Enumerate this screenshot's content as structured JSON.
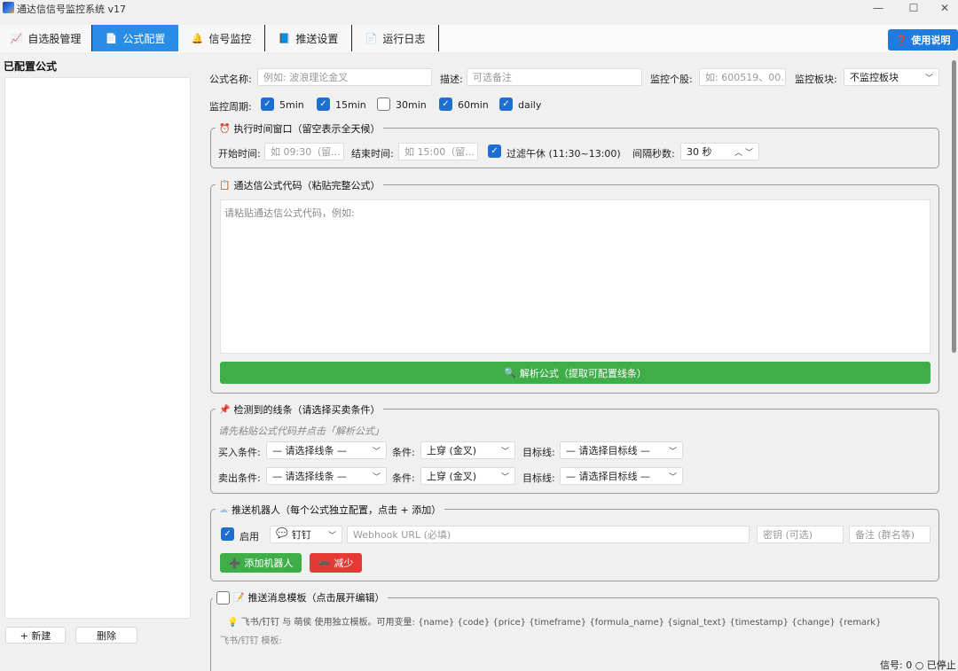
{
  "window": {
    "title": "通达信信号监控系统 v17"
  },
  "tabs": [
    {
      "icon": "📈",
      "label": "自选股管理"
    },
    {
      "icon": "📄",
      "label": "公式配置"
    },
    {
      "icon": "🔔",
      "label": "信号监控"
    },
    {
      "icon": "📘",
      "label": "推送设置"
    },
    {
      "icon": "📄",
      "label": "运行日志"
    }
  ],
  "help_button": {
    "icon": "❓",
    "label": "使用说明"
  },
  "left_panel": {
    "title": "已配置公式",
    "new_button": "+ 新建",
    "delete_button": "删除"
  },
  "form": {
    "name_label": "公式名称:",
    "name_placeholder": "例如: 波浪理论金叉",
    "desc_label": "描述:",
    "desc_placeholder": "可选备注",
    "stock_label": "监控个股:",
    "stock_placeholder": "如: 600519、00...",
    "board_label": "监控板块:",
    "board_value": "不监控板块",
    "period_label": "监控周期:",
    "periods": [
      {
        "label": "5min",
        "checked": true
      },
      {
        "label": "15min",
        "checked": true
      },
      {
        "label": "30min",
        "checked": false
      },
      {
        "label": "60min",
        "checked": true
      },
      {
        "label": "daily",
        "checked": true
      }
    ]
  },
  "time_window": {
    "title": "执行时间窗口（留空表示全天候）",
    "start_label": "开始时间:",
    "start_placeholder": "如 09:30（留...",
    "end_label": "结束时间:",
    "end_placeholder": "如 15:00（留...",
    "lunch_label": "过滤午休 (11:30~13:00)",
    "interval_label": "间隔秒数:",
    "interval_value": "30 秒"
  },
  "code_section": {
    "title": "通达信公式代码（粘贴完整公式）",
    "placeholder": "请粘贴通达信公式代码，例如:",
    "parse_button": "解析公式（提取可配置线条）"
  },
  "lines_section": {
    "title": "检测到的线条（请选择买卖条件）",
    "hint": "请先粘贴公式代码并点击「解析公式」",
    "buy_label": "买入条件:",
    "sell_label": "卖出条件:",
    "line_select": "— 请选择线条 —",
    "cond_label": "条件:",
    "cond_value": "上穿 (金叉)",
    "target_label": "目标线:",
    "target_value": "— 请选择目标线 —"
  },
  "robot_section": {
    "title": "推送机器人（每个公式独立配置，点击 + 添加）",
    "enable_label": "启用",
    "platform_value": "钉钉",
    "webhook_placeholder": "Webhook URL (必填)",
    "secret_placeholder": "密钥 (可选)",
    "remark_placeholder": "备注 (群名等)",
    "add_button": "添加机器人",
    "remove_button": "减少"
  },
  "template_section": {
    "title": "推送消息模板（点击展开编辑）",
    "tip": "飞书/钉钉 与 萌侯 使用独立模板。可用变量: {name} {code} {price} {timeframe} {formula_name} {signal_text} {timestamp} {change} {remark}",
    "feishu_label": "飞书/钉钉 模板:"
  },
  "status": {
    "signals": "信号: 0",
    "state": "○ 已停止"
  }
}
